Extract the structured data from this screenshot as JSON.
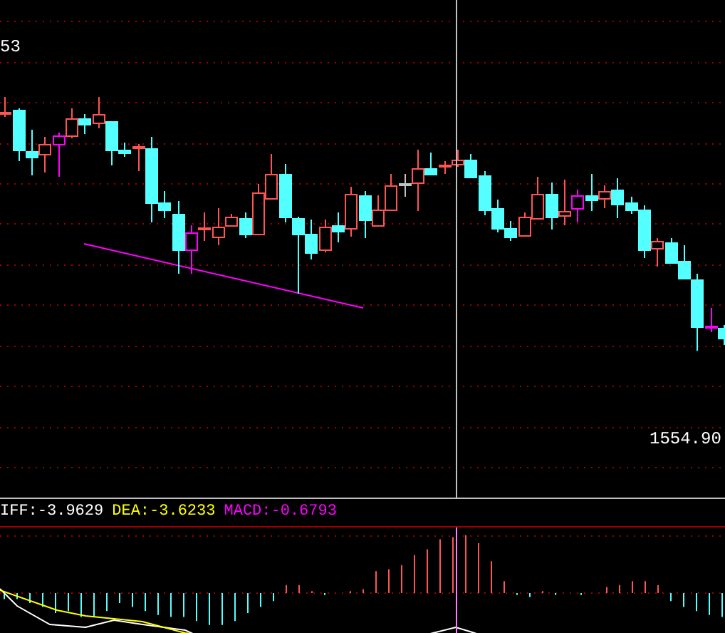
{
  "price_chart": {
    "top_label": "53",
    "bottom_label": "1554.90"
  },
  "indicator_legend": [
    {
      "text": "IFF:-3.9629",
      "color": "#ffffff"
    },
    {
      "text": "DEA:-3.6233",
      "color": "#ffff00"
    },
    {
      "text": "MACD:-0.6793",
      "color": "#ff00ff"
    }
  ]
}
